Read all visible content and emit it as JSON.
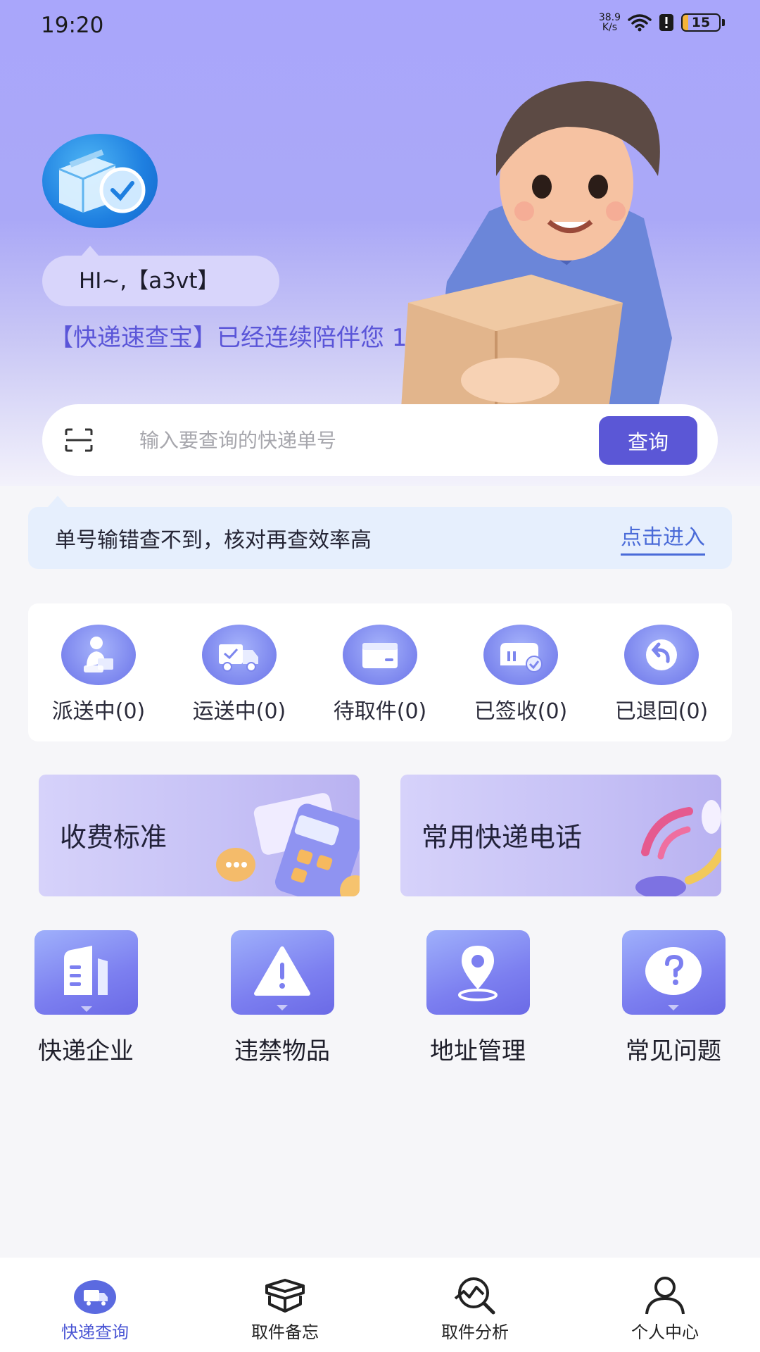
{
  "status_bar": {
    "time": "19:20",
    "net_speed_value": "38.9",
    "net_speed_unit": "K/s",
    "battery": "15",
    "battery_level": 0.15
  },
  "hero": {
    "greeting": "HI~,【a3vt】",
    "companion_text": "【快递速查宝】已经连续陪伴您 1 天",
    "logo_icon": "package-check-icon",
    "mascot": "delivery-man-illustration"
  },
  "search": {
    "placeholder": "输入要查询的快递单号",
    "value": "",
    "button": "查询",
    "scan_icon": "scan-icon"
  },
  "tip": {
    "text": "单号输错查不到，核对再查效率高",
    "link": "点击进入"
  },
  "parcel_status": [
    {
      "label": "派送中(0)",
      "icon": "courier-icon"
    },
    {
      "label": "运送中(0)",
      "icon": "truck-icon"
    },
    {
      "label": "待取件(0)",
      "icon": "pickup-box-icon"
    },
    {
      "label": "已签收(0)",
      "icon": "signed-icon"
    },
    {
      "label": "已退回(0)",
      "icon": "return-icon"
    }
  ],
  "features": [
    {
      "title": "收费标准",
      "icon": "calculator-icon"
    },
    {
      "title": "常用快递电话",
      "icon": "telephone-icon"
    }
  ],
  "services": [
    {
      "label": "快递企业",
      "icon": "building-icon"
    },
    {
      "label": "违禁物品",
      "icon": "warning-icon"
    },
    {
      "label": "地址管理",
      "icon": "location-pin-icon"
    },
    {
      "label": "常见问题",
      "icon": "question-icon"
    }
  ],
  "tabs": [
    {
      "label": "快递查询",
      "icon": "delivery-van-icon",
      "active": true
    },
    {
      "label": "取件备忘",
      "icon": "open-box-icon",
      "active": false
    },
    {
      "label": "取件分析",
      "icon": "analysis-search-icon",
      "active": false
    },
    {
      "label": "个人中心",
      "icon": "user-icon",
      "active": false
    }
  ],
  "colors": {
    "primary": "#5b57d6",
    "hero_gradient_top": "#a9a6fb",
    "tip_bg": "#e6effd",
    "link": "#4a6bd8",
    "active_tab": "#4a55d4"
  }
}
